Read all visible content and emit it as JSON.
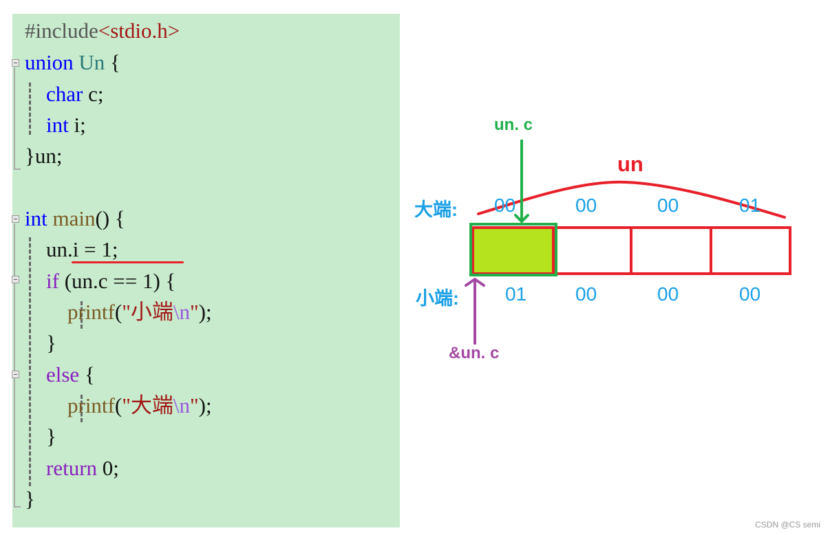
{
  "code": {
    "lines": [
      {
        "parts": [
          {
            "t": "#include",
            "c": "pp"
          },
          {
            "t": "<stdio.h>",
            "c": "str"
          }
        ]
      },
      {
        "parts": [
          {
            "t": "union ",
            "c": "kw"
          },
          {
            "t": "Un ",
            "c": "type"
          },
          {
            "t": "{",
            "c": ""
          }
        ]
      },
      {
        "parts": [
          {
            "t": "    char ",
            "c": "kw"
          },
          {
            "t": "c;",
            "c": ""
          }
        ]
      },
      {
        "parts": [
          {
            "t": "    int ",
            "c": "kw"
          },
          {
            "t": "i;",
            "c": ""
          }
        ]
      },
      {
        "parts": [
          {
            "t": "}un;",
            "c": ""
          }
        ]
      },
      {
        "parts": []
      },
      {
        "parts": [
          {
            "t": "int ",
            "c": "kw"
          },
          {
            "t": "main",
            "c": "fn"
          },
          {
            "t": "() {",
            "c": ""
          }
        ]
      },
      {
        "parts": [
          {
            "t": "    un.i = 1;",
            "c": ""
          }
        ]
      },
      {
        "parts": [
          {
            "t": "    if ",
            "c": "kw2"
          },
          {
            "t": "(un.c == 1) {",
            "c": ""
          }
        ]
      },
      {
        "parts": [
          {
            "t": "        printf",
            "c": "fn"
          },
          {
            "t": "(",
            "c": ""
          },
          {
            "t": "\"小端",
            "c": "str"
          },
          {
            "t": "\\n",
            "c": "esc"
          },
          {
            "t": "\"",
            "c": "str"
          },
          {
            "t": ");",
            "c": ""
          }
        ]
      },
      {
        "parts": [
          {
            "t": "    }",
            "c": ""
          }
        ]
      },
      {
        "parts": [
          {
            "t": "    else ",
            "c": "kw2"
          },
          {
            "t": "{",
            "c": ""
          }
        ]
      },
      {
        "parts": [
          {
            "t": "        printf",
            "c": "fn"
          },
          {
            "t": "(",
            "c": ""
          },
          {
            "t": "\"大端",
            "c": "str"
          },
          {
            "t": "\\n",
            "c": "esc"
          },
          {
            "t": "\"",
            "c": "str"
          },
          {
            "t": ");",
            "c": ""
          }
        ]
      },
      {
        "parts": [
          {
            "t": "    }",
            "c": ""
          }
        ]
      },
      {
        "parts": [
          {
            "t": "    return ",
            "c": "kw2"
          },
          {
            "t": "0;",
            "c": ""
          }
        ]
      },
      {
        "parts": [
          {
            "t": "}",
            "c": ""
          }
        ]
      }
    ]
  },
  "diagram": {
    "union_label": "un",
    "member_pointer_label": "un. c",
    "address_label": "&un. c",
    "big_endian_label": "大端:",
    "little_endian_label": "小端:",
    "big_endian_bytes": [
      "00",
      "00",
      "00",
      "01"
    ],
    "little_endian_bytes": [
      "01",
      "00",
      "00",
      "00"
    ],
    "highlighted_byte_index": 0,
    "colors": {
      "union_red": "#e8202a",
      "member_green": "#22b04b",
      "address_purple": "#a349a4",
      "byte_blue": "#1aa0e6",
      "highlight_fill": "#b5e31e"
    }
  },
  "watermark": "CSDN @CS semi"
}
